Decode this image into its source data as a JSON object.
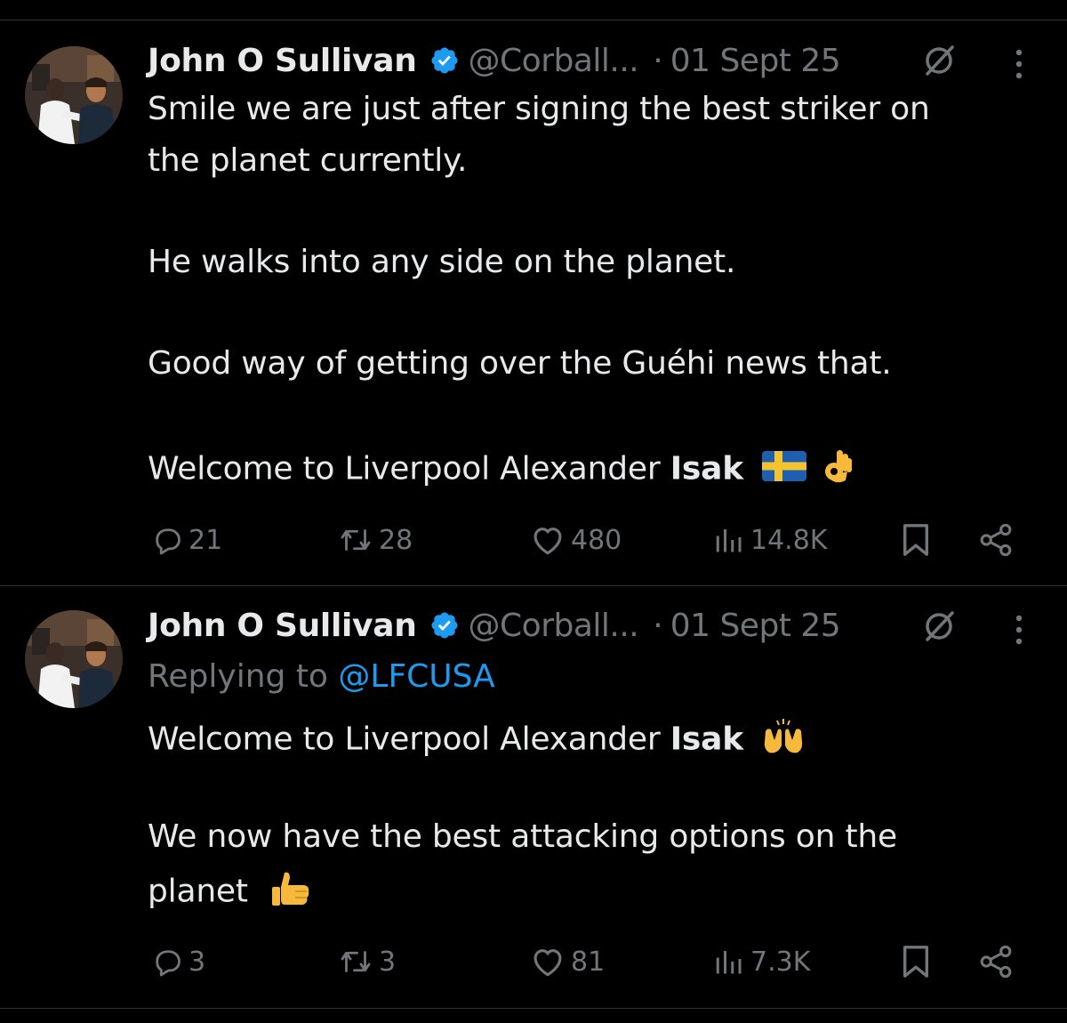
{
  "tweets": [
    {
      "author": {
        "name": "John O Sullivan",
        "handle": "@Corball...",
        "verified": true
      },
      "separator": "·",
      "date": "01 Sept 25",
      "lines": [
        {
          "text": "Smile we are just after signing the best striker on"
        },
        {
          "text": "the planet currently."
        },
        {
          "text": "He walks into any side on the planet."
        },
        {
          "text": "Good way of getting over the Guéhi news that."
        },
        {
          "text": "Welcome to Liverpool Alexander ",
          "bold": "Isak"
        }
      ],
      "stats": {
        "replies": "21",
        "reposts": "28",
        "likes": "480",
        "views": "14.8K"
      }
    },
    {
      "author": {
        "name": "John O Sullivan",
        "handle": "@Corball...",
        "verified": true
      },
      "separator": "·",
      "date": "01 Sept 25",
      "replying_to": {
        "label": "Replying to ",
        "mention": "@LFCUSA"
      },
      "lines": [
        {
          "text": "Welcome to Liverpool Alexander ",
          "bold": "Isak"
        },
        {
          "text": "We now have the best attacking options on the"
        },
        {
          "text": "planet"
        }
      ],
      "stats": {
        "replies": "3",
        "reposts": "3",
        "likes": "81",
        "views": "7.3K"
      }
    }
  ],
  "icons": {
    "verified": "verified-badge-icon",
    "grok": "grok-icon",
    "more": "more-vertical-icon",
    "reply": "reply-icon",
    "repost": "repost-icon",
    "like": "heart-icon",
    "views": "views-icon",
    "bookmark": "bookmark-icon",
    "share": "share-icon",
    "emoji_flag": "sweden-flag-icon",
    "emoji_ok": "ok-hand-icon",
    "emoji_raised": "raised-hands-icon",
    "emoji_thumbs": "thumbs-up-icon"
  },
  "colors": {
    "background": "#000000",
    "text": "#e7e9ea",
    "muted": "#71767b",
    "accent": "#1d9bf0",
    "divider": "#2f3336"
  }
}
